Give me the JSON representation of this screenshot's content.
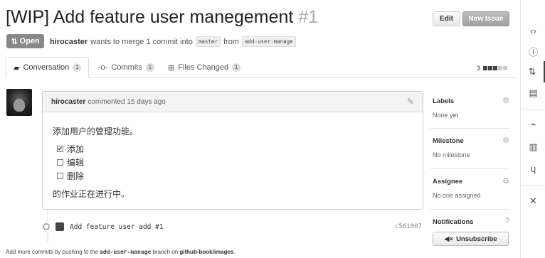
{
  "header": {
    "title": "[WIP] Add feature user manegement",
    "number": "#1",
    "edit_label": "Edit",
    "new_issue_label": "New Issue"
  },
  "pr_meta": {
    "state": "Open",
    "user": "hirocaster",
    "text1": "wants to merge 1 commit into",
    "base_branch": "master",
    "text2": "from",
    "head_branch": "add-user-manage"
  },
  "tabs": [
    {
      "label": "Conversation",
      "count": "1",
      "icon": "comment-icon"
    },
    {
      "label": "Commits",
      "count": "1",
      "icon": "commit-icon"
    },
    {
      "label": "Files Changed",
      "count": "1",
      "icon": "file-diff-icon"
    }
  ],
  "diffstat": {
    "count": "3"
  },
  "comment": {
    "author": "hirocaster",
    "action": "commented 15 days ago",
    "paragraph1": "添加用户的管理功能。",
    "tasks": [
      {
        "label": "添加",
        "checked": true
      },
      {
        "label": "编辑",
        "checked": false
      },
      {
        "label": "删除",
        "checked": false
      }
    ],
    "paragraph2": "的作业正在进行中。"
  },
  "commit": {
    "message": "Add feature user add #1",
    "sha": "c561007"
  },
  "footer": {
    "prefix": "Add more commits by pushing to the",
    "branch": "add-user-manage",
    "middle": "branch on",
    "repo": "github-book/images",
    "suffix": "."
  },
  "sidebar": {
    "labels": {
      "title": "Labels",
      "value": "None yet"
    },
    "milestone": {
      "title": "Milestone",
      "value": "No milestone"
    },
    "assignee": {
      "title": "Assignee",
      "value": "No one assigned"
    },
    "notifications": {
      "title": "Notifications",
      "button": "Unsubscribe"
    }
  },
  "repo_nav": {
    "items": [
      "code-icon",
      "issues-icon",
      "pull-request-icon",
      "wiki-icon",
      "pulse-icon",
      "graphs-icon",
      "network-icon",
      "settings-icon"
    ]
  }
}
